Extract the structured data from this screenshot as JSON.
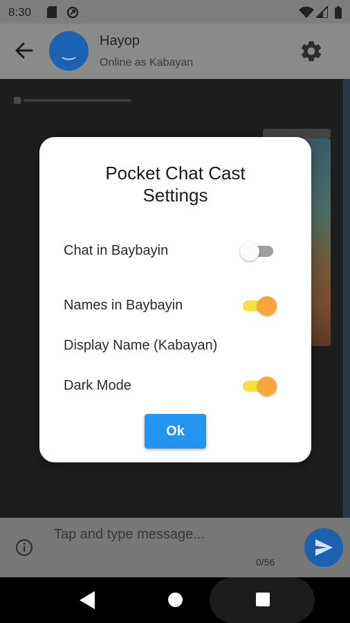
{
  "status_bar": {
    "time": "8:30",
    "icons": [
      "sd-card-icon",
      "data-saver-icon",
      "wifi-icon",
      "signal-icon",
      "battery-icon"
    ]
  },
  "app_bar": {
    "back_icon": "arrow-back-icon",
    "avatar_glyph": "‿",
    "title": "Hayop",
    "subtitle": "Online as Kabayan",
    "settings_icon": "gear-icon"
  },
  "composer": {
    "placeholder": "Tap and type message...",
    "value": "",
    "counter": "0/56",
    "info_icon": "info-icon",
    "send_icon": "send-icon"
  },
  "dialog": {
    "title_line1": "Pocket Chat Cast",
    "title_line2": "Settings",
    "settings": [
      {
        "label": "Chat in Baybayin",
        "control": "switch",
        "on": false
      },
      {
        "label": "Names in Baybayin",
        "control": "switch",
        "on": true
      },
      {
        "label": "Display Name (Kabayan)",
        "control": "text"
      },
      {
        "label": "Dark Mode",
        "control": "switch",
        "on": true
      }
    ],
    "ok_label": "Ok"
  },
  "colors": {
    "accent_blue": "#2295F2",
    "switch_thumb_on": "#F7A63A",
    "switch_track_on": "#F7E13F",
    "avatar_blue": "#1C62B0"
  },
  "nav_bar": {
    "back_icon": "nav-back-icon",
    "home_icon": "nav-home-icon",
    "recents_icon": "nav-recents-icon"
  }
}
